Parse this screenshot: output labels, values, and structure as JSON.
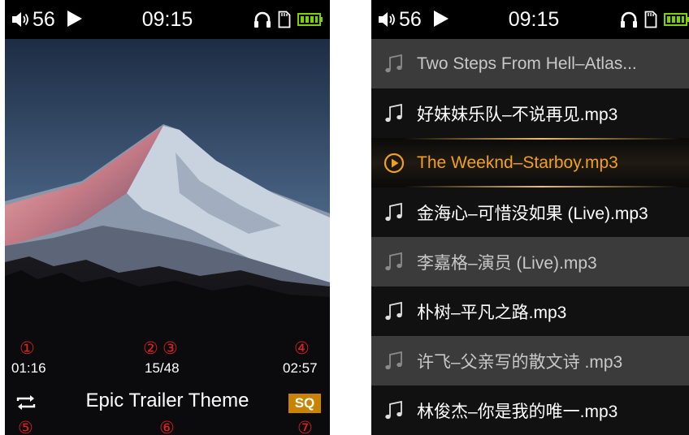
{
  "status": {
    "volume": "56",
    "time": "09:15"
  },
  "player": {
    "elapsed": "01:16",
    "track_index": "15",
    "track_total": "48",
    "duration": "02:57",
    "title": "Epic Trailer Theme",
    "quality_badge": "SQ",
    "markers": [
      "①",
      "②",
      "③",
      "④",
      "⑤",
      "⑥",
      "⑦"
    ]
  },
  "playlist": {
    "items": [
      {
        "label": "Two Steps From Hell–Atlas...",
        "state": "dim"
      },
      {
        "label": "好妹妹乐队–不说再见.mp3",
        "state": "normal"
      },
      {
        "label": "The Weeknd–Starboy.mp3",
        "state": "playing"
      },
      {
        "label": "金海心–可惜没如果 (Live).mp3",
        "state": "normal"
      },
      {
        "label": "李嘉格–演员 (Live).mp3",
        "state": "dim"
      },
      {
        "label": "朴树–平凡之路.mp3",
        "state": "normal"
      },
      {
        "label": "许飞–父亲写的散文诗 .mp3",
        "state": "dim"
      },
      {
        "label": "林俊杰–你是我的唯一.mp3",
        "state": "normal"
      }
    ]
  },
  "colors": {
    "accent": "#f0a020",
    "badge": "#c88400",
    "marker": "#e02020",
    "battery": "#7fd000"
  }
}
